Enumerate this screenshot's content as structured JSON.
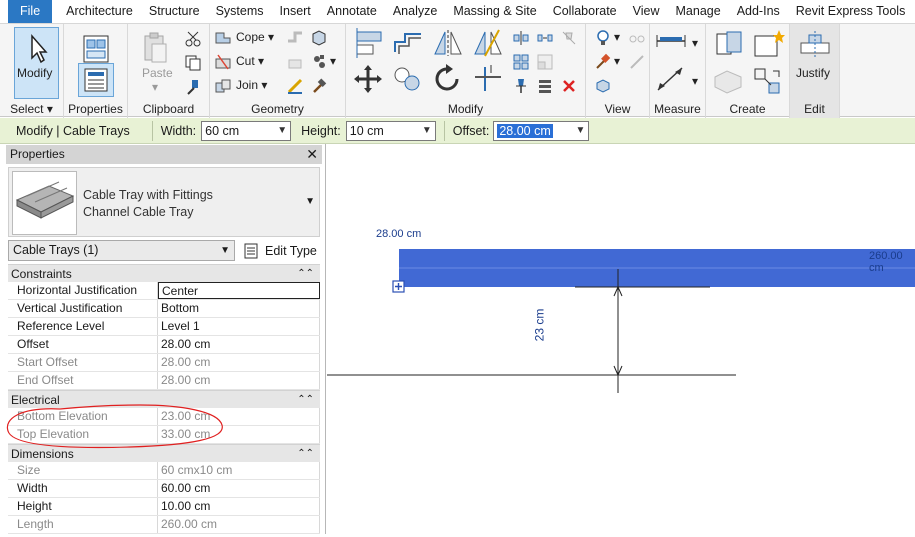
{
  "menu": {
    "items": [
      "File",
      "Architecture",
      "Structure",
      "Systems",
      "Insert",
      "Annotate",
      "Analyze",
      "Massing & Site",
      "Collaborate",
      "View",
      "Manage",
      "Add-Ins",
      "Revit Express Tools"
    ]
  },
  "ribbon": {
    "select": {
      "modify_label": "Modify",
      "group_label": "Select"
    },
    "properties": {
      "label": "Properties"
    },
    "clipboard": {
      "paste_label": "Paste",
      "group_label": "Clipboard"
    },
    "geometry": {
      "cope_label": "Cope",
      "cut_label": "Cut",
      "join_label": "Join",
      "group_label": "Geometry"
    },
    "modify": {
      "group_label": "Modify"
    },
    "view": {
      "group_label": "View"
    },
    "measure": {
      "group_label": "Measure"
    },
    "create": {
      "group_label": "Create"
    },
    "edit": {
      "justify_label": "Justify",
      "group_label": "Edit"
    }
  },
  "options_bar": {
    "context": "Modify | Cable Trays",
    "width_label": "Width:",
    "width_value": "60 cm",
    "height_label": "Height:",
    "height_value": "10 cm",
    "offset_label": "Offset:",
    "offset_value": "28.00 cm"
  },
  "properties": {
    "title": "Properties",
    "type_family": "Cable Tray with Fittings",
    "type_name": "Channel Cable Tray",
    "instance_selector": "Cable Trays (1)",
    "edit_type_label": "Edit Type",
    "sections": [
      {
        "name": "Constraints",
        "rows": [
          {
            "key": "Horizontal Justification",
            "value": "Center"
          },
          {
            "key": "Vertical Justification",
            "value": "Bottom"
          },
          {
            "key": "Reference Level",
            "value": "Level 1"
          },
          {
            "key": "Offset",
            "value": "28.00 cm"
          },
          {
            "key": "Start Offset",
            "value": "28.00 cm"
          },
          {
            "key": "End Offset",
            "value": "28.00 cm"
          }
        ]
      },
      {
        "name": "Electrical",
        "rows": [
          {
            "key": "Bottom Elevation",
            "value": "23.00 cm"
          },
          {
            "key": "Top Elevation",
            "value": "33.00 cm"
          }
        ]
      },
      {
        "name": "Dimensions",
        "rows": [
          {
            "key": "Size",
            "value": "60 cmx10 cm"
          },
          {
            "key": "Width",
            "value": "60.00 cm"
          },
          {
            "key": "Height",
            "value": "10.00 cm"
          },
          {
            "key": "Length",
            "value": "260.00 cm"
          }
        ]
      }
    ]
  },
  "canvas": {
    "offset_tag": "28.00 cm",
    "length_tag": "260.00 cm",
    "dimension_text": "23 cm",
    "tray_color": "#4169d4",
    "annotation_color": "#e02020"
  }
}
